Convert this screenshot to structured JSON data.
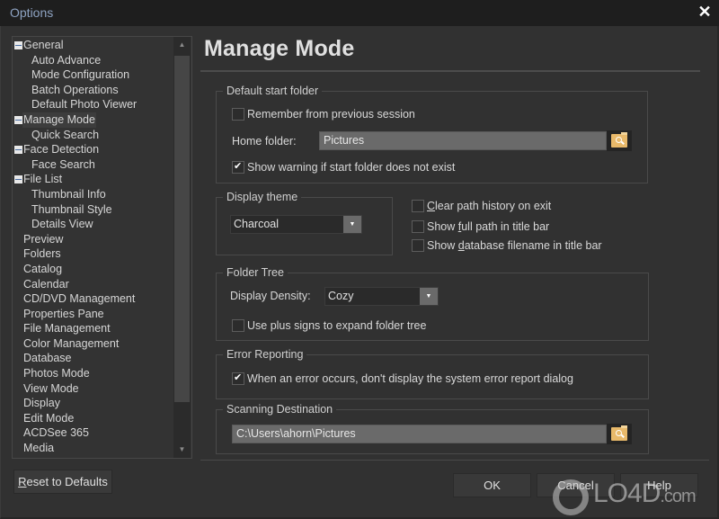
{
  "window": {
    "title": "Options",
    "close_icon": "close-icon"
  },
  "tree": {
    "items": [
      {
        "label": "General",
        "level": 0,
        "expanded": true
      },
      {
        "label": "Auto Advance",
        "level": 1
      },
      {
        "label": "Mode Configuration",
        "level": 1
      },
      {
        "label": "Batch Operations",
        "level": 1
      },
      {
        "label": "Default Photo Viewer",
        "level": 1
      },
      {
        "label": "Manage Mode",
        "level": 0,
        "expanded": true,
        "selected": true
      },
      {
        "label": "Quick Search",
        "level": 1
      },
      {
        "label": "Face Detection",
        "level": 0,
        "expanded": true
      },
      {
        "label": "Face Search",
        "level": 1
      },
      {
        "label": "File List",
        "level": 0,
        "expanded": true
      },
      {
        "label": "Thumbnail Info",
        "level": 1
      },
      {
        "label": "Thumbnail Style",
        "level": 1
      },
      {
        "label": "Details View",
        "level": 1
      },
      {
        "label": "Preview",
        "level": 0
      },
      {
        "label": "Folders",
        "level": 0
      },
      {
        "label": "Catalog",
        "level": 0
      },
      {
        "label": "Calendar",
        "level": 0
      },
      {
        "label": "CD/DVD Management",
        "level": 0
      },
      {
        "label": "Properties Pane",
        "level": 0
      },
      {
        "label": "File Management",
        "level": 0
      },
      {
        "label": "Color Management",
        "level": 0
      },
      {
        "label": "Database",
        "level": 0
      },
      {
        "label": "Photos Mode",
        "level": 0
      },
      {
        "label": "View Mode",
        "level": 0
      },
      {
        "label": "Display",
        "level": 0
      },
      {
        "label": "Edit Mode",
        "level": 0
      },
      {
        "label": "ACDSee 365",
        "level": 0
      },
      {
        "label": "Media",
        "level": 0
      }
    ]
  },
  "reset_button": {
    "pre": "",
    "accel": "R",
    "post": "eset to Defaults"
  },
  "page": {
    "title": "Manage Mode",
    "default_start_folder": {
      "label": "Default start folder",
      "remember": {
        "label": "Remember from previous session",
        "checked": false
      },
      "home_folder_label": "Home folder:",
      "home_folder_value": "Pictures",
      "show_warning": {
        "label": "Show warning if start folder does not exist",
        "checked": true
      }
    },
    "display_theme": {
      "label": "Display theme",
      "value": "Charcoal"
    },
    "options": {
      "clear_history": {
        "accel": "C",
        "rest": "lear path history on exit",
        "checked": false
      },
      "full_path": {
        "pre": "Show ",
        "accel": "f",
        "rest": "ull path in title bar",
        "checked": false
      },
      "db_filename": {
        "pre": "Show ",
        "accel": "d",
        "rest": "atabase filename in title bar",
        "checked": false
      }
    },
    "folder_tree": {
      "label": "Folder Tree",
      "density_label": "Display Density:",
      "density_value": "Cozy",
      "plus_signs": {
        "label": "Use plus signs to expand folder tree",
        "checked": false
      }
    },
    "error_reporting": {
      "label": "Error Reporting",
      "suppress": {
        "label": "When an error occurs, don't display the system error report dialog",
        "checked": true
      }
    },
    "scanning_destination": {
      "label": "Scanning Destination",
      "value": "C:\\Users\\ahorn\\Pictures"
    }
  },
  "buttons": {
    "ok": "OK",
    "cancel": "Cancel",
    "help": "Help"
  },
  "watermark": {
    "brand": "LO4D",
    "suffix": ".com"
  }
}
